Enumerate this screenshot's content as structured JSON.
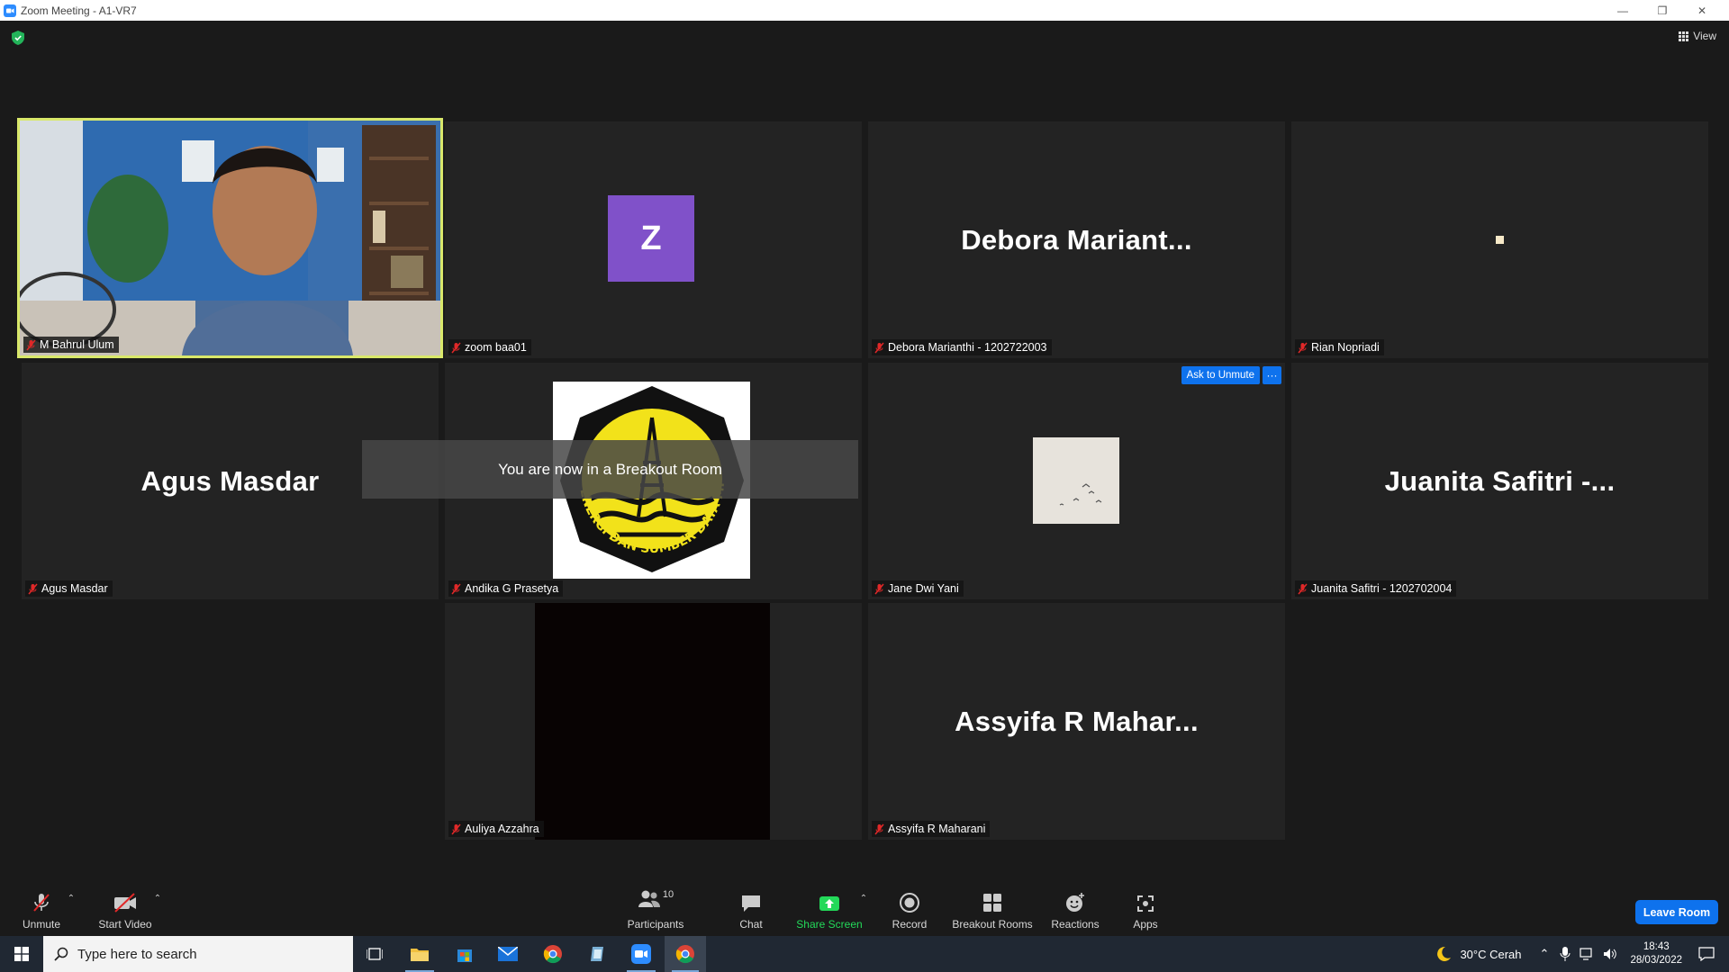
{
  "window": {
    "title": "Zoom Meeting - A1-VR7"
  },
  "header": {
    "view_label": "View"
  },
  "tiles": [
    {
      "name": "M Bahrul Ulum",
      "display": "video",
      "active": true
    },
    {
      "name": "zoom baa01",
      "display": "avatar",
      "avatar_letter": "Z",
      "avatar_color": "#8051c9"
    },
    {
      "name": "Debora Marianthi - 1202722003",
      "display": "name",
      "big_name": "Debora  Mariant..."
    },
    {
      "name": "Rian Nopriadi",
      "display": "small-image"
    },
    {
      "name": "Agus Masdar",
      "display": "name",
      "big_name": "Agus Masdar"
    },
    {
      "name": "Andika G Prasetya",
      "display": "logo",
      "logo_text": "ENERGI DAN SUMBER DAYA MINERAL"
    },
    {
      "name": "Jane Dwi Yani",
      "display": "photo",
      "ask_unmute_label": "Ask to Unmute",
      "more_label": "···"
    },
    {
      "name": "Juanita Safitri - 1202702004",
      "display": "name",
      "big_name": "Juanita Safitri -..."
    },
    {
      "name": "Auliya Azzahra",
      "display": "black-video"
    },
    {
      "name": "Assyifa R Maharani",
      "display": "name",
      "big_name": "Assyifa R Mahar..."
    }
  ],
  "toast": "You are now in a Breakout Room",
  "toolbar": {
    "unmute": "Unmute",
    "start_video": "Start Video",
    "participants": "Participants",
    "participants_count": "10",
    "chat": "Chat",
    "share_screen": "Share Screen",
    "record": "Record",
    "breakout_rooms": "Breakout Rooms",
    "reactions": "Reactions",
    "apps": "Apps",
    "leave_room": "Leave Room"
  },
  "taskbar": {
    "search_placeholder": "Type here to search",
    "weather": "30°C  Cerah",
    "time": "18:43",
    "date": "28/03/2022"
  },
  "colors": {
    "accent": "#0e72ed",
    "active_border": "#d9e86a",
    "share_green": "#23d959"
  }
}
